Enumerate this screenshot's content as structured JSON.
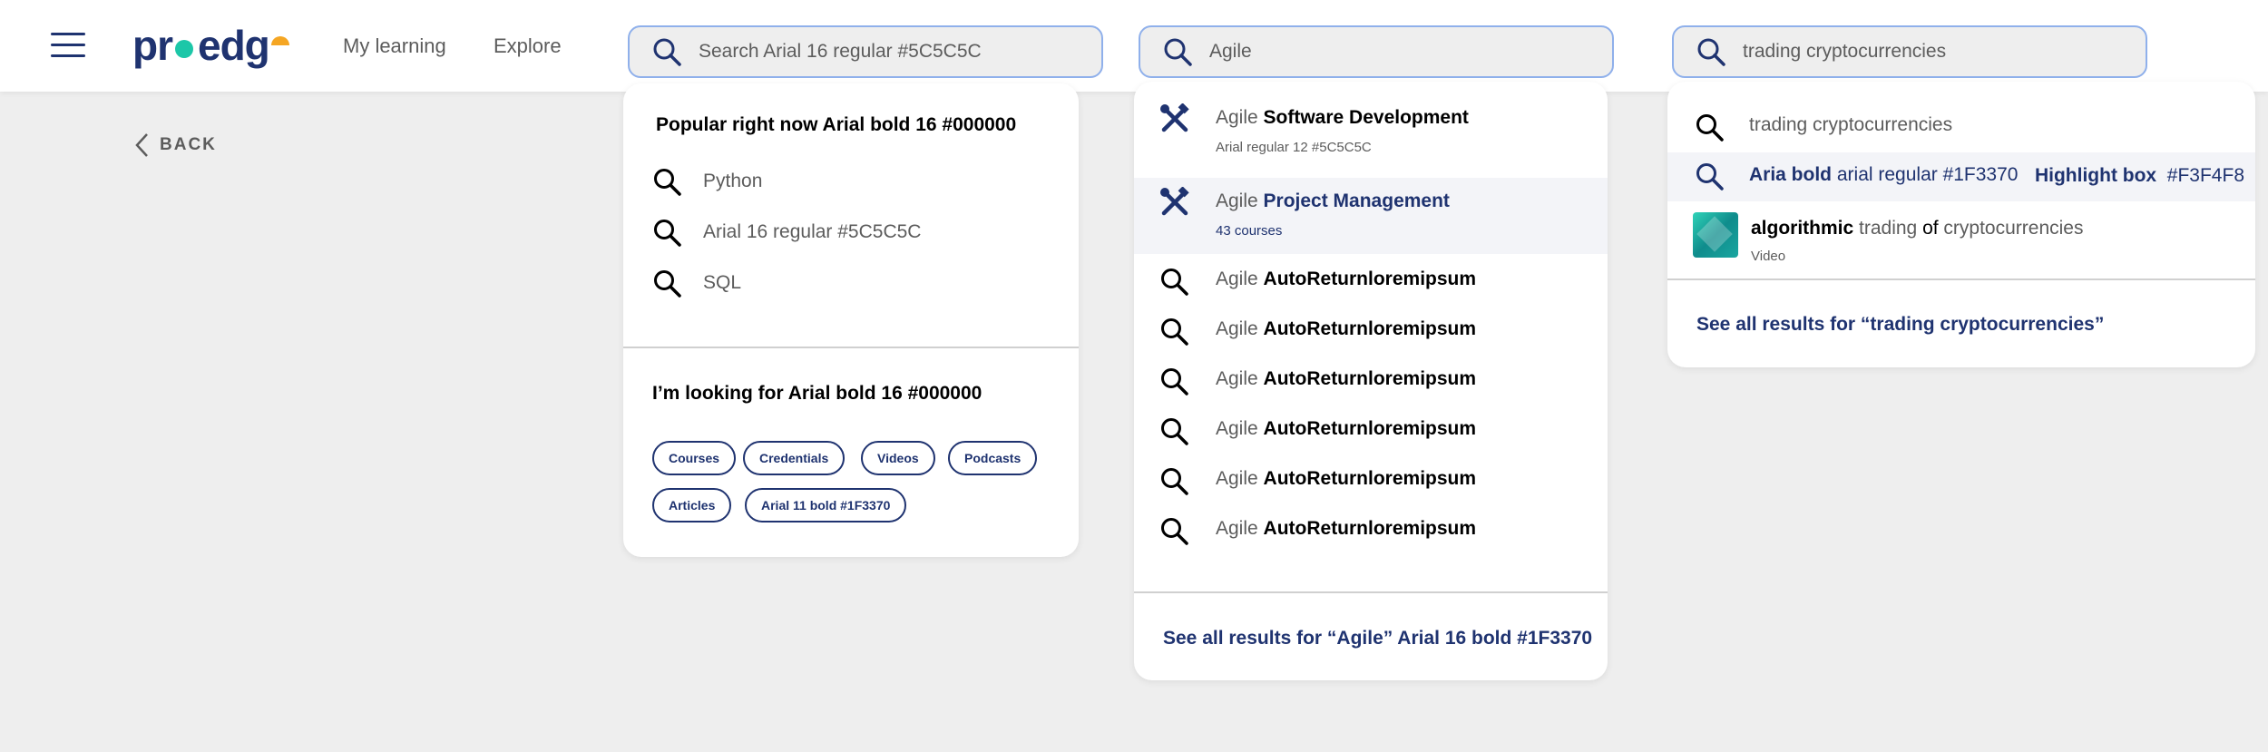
{
  "header": {
    "logo": {
      "part1": "pr",
      "part2": "edg"
    },
    "nav": [
      "My learning",
      "Explore"
    ],
    "searches": [
      {
        "value": "Search Arial 16 regular #5C5C5C"
      },
      {
        "value": "Agile"
      },
      {
        "value": "trading cryptocurrencies"
      }
    ]
  },
  "back": {
    "label": "BACK"
  },
  "popular_panel": {
    "title": "Popular right now Arial bold 16 #000000",
    "items": [
      "Python",
      "Arial 16 regular #5C5C5C",
      "SQL"
    ],
    "looking_title": "I’m looking for Arial bold 16 #000000",
    "chips": [
      "Courses",
      "Credentials",
      "Videos",
      "Podcasts",
      "Articles",
      "Arial 11 bold #1F3370"
    ]
  },
  "agile_panel": {
    "rows": [
      {
        "icon": "tools-icon",
        "prefix": "Agile ",
        "bold": "Software Development",
        "sub": "Arial regular 12 #5C5C5C",
        "highlighted": false
      },
      {
        "icon": "tools-icon",
        "prefix": "Agile ",
        "bold": "Project Management",
        "sub": "43 courses",
        "highlighted": true
      },
      {
        "icon": "search-icon",
        "prefix": "Agile ",
        "bold": "AutoReturnloremipsum"
      },
      {
        "icon": "search-icon",
        "prefix": "Agile ",
        "bold": "AutoReturnloremipsum"
      },
      {
        "icon": "search-icon",
        "prefix": "Agile ",
        "bold": "AutoReturnloremipsum"
      },
      {
        "icon": "search-icon",
        "prefix": "Agile ",
        "bold": "AutoReturnloremipsum"
      },
      {
        "icon": "search-icon",
        "prefix": "Agile ",
        "bold": "AutoReturnloremipsum"
      },
      {
        "icon": "search-icon",
        "prefix": "Agile ",
        "bold": "AutoReturnloremipsum"
      }
    ],
    "see_all": "See all results for “Agile” Arial 16 bold #1F3370"
  },
  "trading_panel": {
    "row1": "trading cryptocurrencies",
    "row2": {
      "bold": "Aria bold",
      "rest": " arial regular #1F3370",
      "hl_bold": "Highlight box",
      "hl_rest": "  #F3F4F8"
    },
    "row3": {
      "w1": "algorithmic",
      "w2": " trading ",
      "w3": "of",
      "w4": " cryptocurrencies",
      "sub": "Video"
    },
    "see_all": "See all results for “trading cryptocurrencies”"
  },
  "colors": {
    "accent": "#1F3370",
    "text": "#5C5C5C",
    "highlight": "#F3F4F8",
    "search_border": "#8FB0EB",
    "background": "#EEEEEE",
    "logo_green": "#1CC7A8",
    "logo_orange": "#F5A623"
  }
}
